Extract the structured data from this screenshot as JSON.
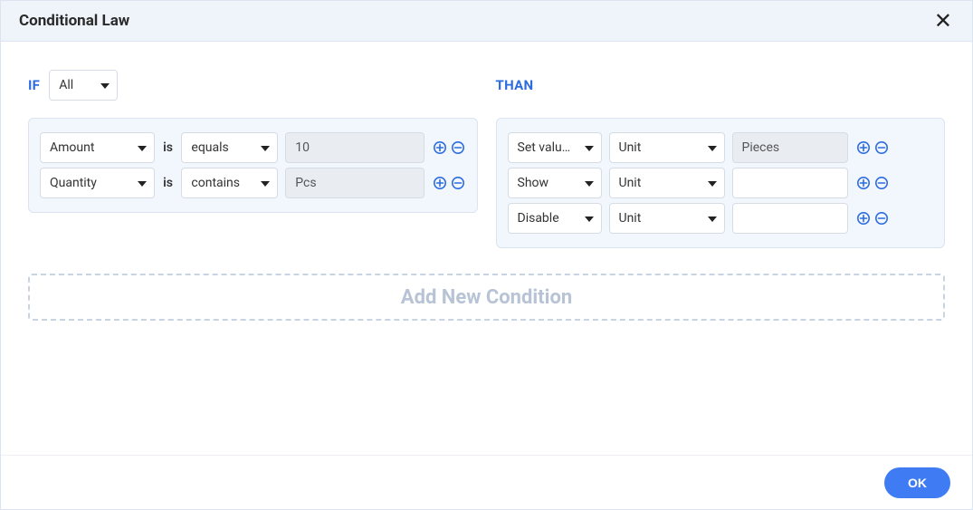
{
  "dialog": {
    "title": "Conditional Law",
    "ok_label": "OK"
  },
  "if_section": {
    "keyword": "IF",
    "scope": "All",
    "is_label": "is",
    "rows": [
      {
        "field": "Amount",
        "operator": "equals",
        "value": "10"
      },
      {
        "field": "Quantity",
        "operator": "contains",
        "value": "Pcs"
      }
    ]
  },
  "than_section": {
    "keyword": "THAN",
    "rows": [
      {
        "action": "Set value ...",
        "field": "Unit",
        "value": "Pieces",
        "value_readonly": true
      },
      {
        "action": "Show",
        "field": "Unit",
        "value": "",
        "value_readonly": false
      },
      {
        "action": "Disable",
        "field": "Unit",
        "value": "",
        "value_readonly": false
      }
    ]
  },
  "add_new_label": "Add New Condition"
}
